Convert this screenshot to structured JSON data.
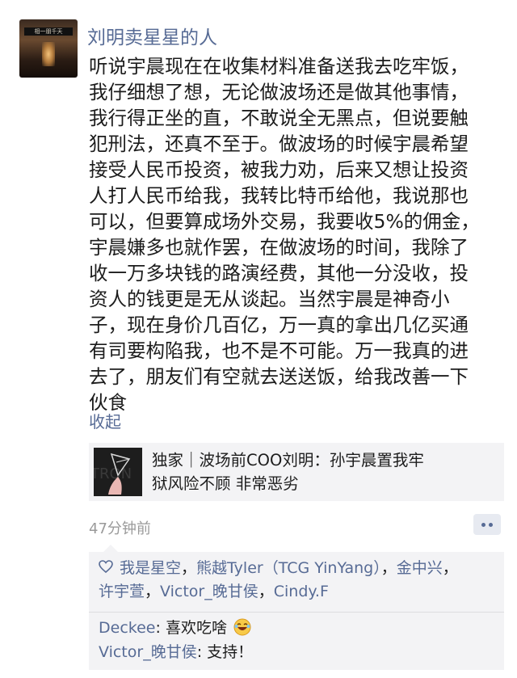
{
  "post": {
    "author": "刘明卖星星的人",
    "avatar_sign": "相一朋千天",
    "lines": [
      "听说宇晨现在在收集材料准备送我去吃牢饭，",
      "我仔细想了想，无论做波场还是做其他事情，",
      "我行得正坐的直，不敢说全无黑点，但说要触",
      "犯刑法，还真不至于。做波场的时候宇晨希望",
      "接受人民币投资，被我力劝，后来又想让投资",
      "人打人民币给我，我转比特币给他，我说那也",
      "可以，但要算成场外交易，我要收5%的佣金，",
      "宇晨嫌多也就作罢，在做波场的时间，我除了",
      "收一万多块钱的路演经费，其他一分没收，投",
      "资人的钱更是无从谈起。当然宇晨是神奇小",
      "子，现在身价几百亿，万一真的拿出几亿买通",
      "有司要构陷我，也不是不可能。万一我真的进",
      "去了，朋友们有空就去送送饭，给我改善一下",
      "伙食"
    ],
    "collapse_label": "收起",
    "share": {
      "title_line1": "独家｜波场前COO刘明：孙宇晨置我牢",
      "title_line2": "狱风险不顾 非常恶劣",
      "thumb_text": "TRON"
    },
    "time": "47分钟前"
  },
  "likes": {
    "names": [
      "我是星空",
      "熊越Tyler（TCG YinYang）",
      "金中兴",
      "许宇萱",
      "Victor_晚甘侯",
      "Cindy.F"
    ],
    "separator": "，"
  },
  "comments": [
    {
      "user": "Deckee",
      "colon": ": ",
      "text": "喜欢吃啥",
      "emoji": "laughing-emoji"
    },
    {
      "user": "Victor_晚甘侯",
      "colon": ": ",
      "text": "支持！"
    }
  ],
  "colors": {
    "link": "#576b95",
    "panel": "#f3f3f5",
    "text": "#1c1c1c",
    "meta": "#9a9a9a"
  }
}
